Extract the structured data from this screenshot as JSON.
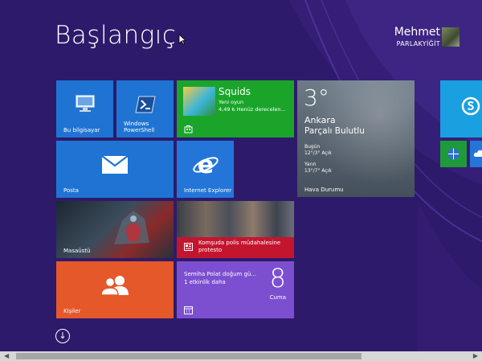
{
  "screen": {
    "title": "Başlangıç"
  },
  "user": {
    "first_name": "Mehmet",
    "last_name": "PARLAKYİĞİT"
  },
  "tiles": {
    "this_pc": "Bu bilgisayar",
    "powershell": "Windows\nPowerShell",
    "squids": {
      "title": "Squids",
      "line1": "Yeni oyun",
      "line2": "4,49 ₺ Henüz derecelen..."
    },
    "weather": {
      "temp": "3°",
      "city": "Ankara",
      "condition": "Parçalı Bulutlu",
      "today_label": "Bugün",
      "today_value": "12°/3° Açık",
      "tomorrow_label": "Yarın",
      "tomorrow_value": "13°/7° Açık",
      "app_name": "Hava Durumu"
    },
    "mail": "Posta",
    "ie": "Internet Explorer",
    "desktop": "Masaüstü",
    "news": "Komşuda polis müdahalesine protesto",
    "people": "Kişiler",
    "calendar": {
      "event": "Semiha Polat doğum gü...",
      "more": "1 etkinlik daha",
      "day": "8",
      "weekday": "Cuma"
    }
  },
  "colors": {
    "background": "#2e1a6b",
    "tile_blue": "#1f74d3",
    "tile_green": "#1aa52a",
    "tile_orange": "#e4582a",
    "tile_purple": "#7c4fd0",
    "tile_red": "#c4152f"
  },
  "icons": [
    "this-pc-icon",
    "powershell-icon",
    "store-icon",
    "mail-icon",
    "internet-explorer-icon",
    "news-icon",
    "people-icon",
    "calendar-icon",
    "skype-icon",
    "scroll-down-icon"
  ]
}
